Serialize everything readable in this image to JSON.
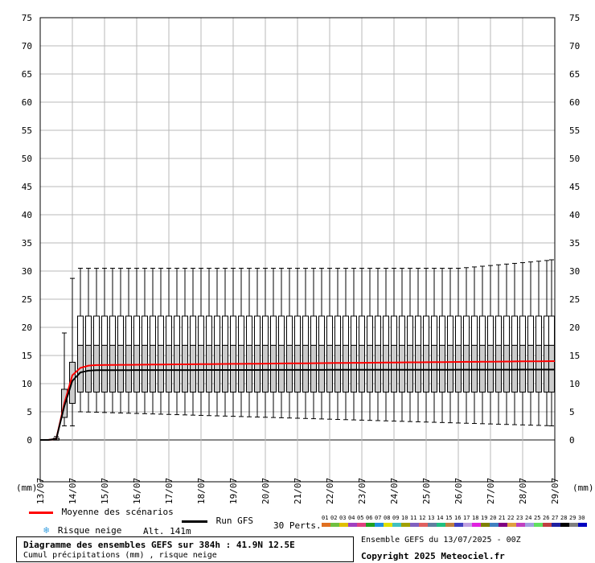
{
  "chart_data": {
    "type": "boxplot",
    "title": "Diagramme des ensembles GEFS sur 384h : 41.9N 12.5E",
    "subtitle": "Cumul précipitations (mm) , risque neige",
    "y_unit": "(mm)",
    "ylim": [
      -9,
      77
    ],
    "yticks": [
      0,
      5,
      10,
      15,
      20,
      25,
      30,
      35,
      40,
      45,
      50,
      55,
      60,
      65,
      70,
      75
    ],
    "x_date_labels": [
      "13/07",
      "14/07",
      "15/07",
      "16/07",
      "17/07",
      "18/07",
      "19/07",
      "20/07",
      "21/07",
      "22/07",
      "23/07",
      "24/07",
      "25/07",
      "26/07",
      "27/07",
      "28/07",
      "29/07"
    ],
    "step_hours": 6,
    "n_steps": 64,
    "grid": true,
    "legend": {
      "mean_label": "Moyenne des scénarios",
      "snow_label": "Risque neige",
      "run_label": "Run GFS",
      "altitude": "Alt. 141m",
      "perts_label": "30 Perts.",
      "pert_numbers": [
        "01",
        "02",
        "03",
        "04",
        "05",
        "06",
        "07",
        "08",
        "09",
        "10",
        "11",
        "12",
        "13",
        "14",
        "15",
        "16",
        "17",
        "18",
        "19",
        "20",
        "21",
        "22",
        "23",
        "24",
        "25",
        "26",
        "27",
        "28",
        "29",
        "30"
      ],
      "pert_colors": [
        "#e07020",
        "#70c040",
        "#e0c000",
        "#a040c0",
        "#e04080",
        "#20a020",
        "#2090e0",
        "#e0e000",
        "#40c0c0",
        "#a0a000",
        "#8060c0",
        "#e06060",
        "#6080a0",
        "#20c080",
        "#c08040",
        "#4040c0",
        "#c0a0e0",
        "#e020e0",
        "#808000",
        "#4080c0",
        "#800080",
        "#e0a040",
        "#c040c0",
        "#a0a0e0",
        "#60e060",
        "#c04040",
        "#2020a0",
        "#000000",
        "#808080",
        "#0000c0"
      ],
      "mean_color": "#ff0000",
      "run_color": "#000000",
      "box_color": "#cccccc"
    },
    "ensemble_info": "Ensemble GEFS du 13/07/2025 - 00Z",
    "copyright": "Copyright 2025 Meteociel.fr",
    "series": [
      {
        "name": "Moyenne des scénarios",
        "role": "mean",
        "start_values": [
          0,
          0,
          0.2,
          6.5,
          11.5,
          12.8,
          13.2
        ],
        "steady_start": 13.3,
        "steady_end": 14.0
      },
      {
        "name": "Run GFS",
        "role": "run",
        "start_values": [
          0,
          0,
          0.2,
          6.0,
          10.5,
          12.0,
          12.3
        ],
        "steady_start": 12.4,
        "steady_end": 12.5
      }
    ],
    "boxes": {
      "early": [
        {
          "min": 0,
          "q1": 0,
          "med": 0,
          "q3": 0,
          "max": 0
        },
        {
          "min": 0,
          "q1": 0,
          "med": 0,
          "q3": 0,
          "max": 0
        },
        {
          "min": 0,
          "q1": 0,
          "med": 0,
          "q3": 0.3,
          "max": 0.6
        },
        {
          "min": 2.5,
          "q1": 4.0,
          "med": 5.5,
          "q3": 9.0,
          "max": 19.0
        },
        {
          "min": 2.5,
          "q1": 6.5,
          "med": 9.5,
          "q3": 13.8,
          "max": 28.7
        }
      ],
      "steady": {
        "min": 5.0,
        "q1": 8.5,
        "med": 12.5,
        "q3": 16.8,
        "p90": 22.0,
        "max": 30.5
      },
      "end_max": 32.0,
      "end_min": 2.5
    }
  }
}
